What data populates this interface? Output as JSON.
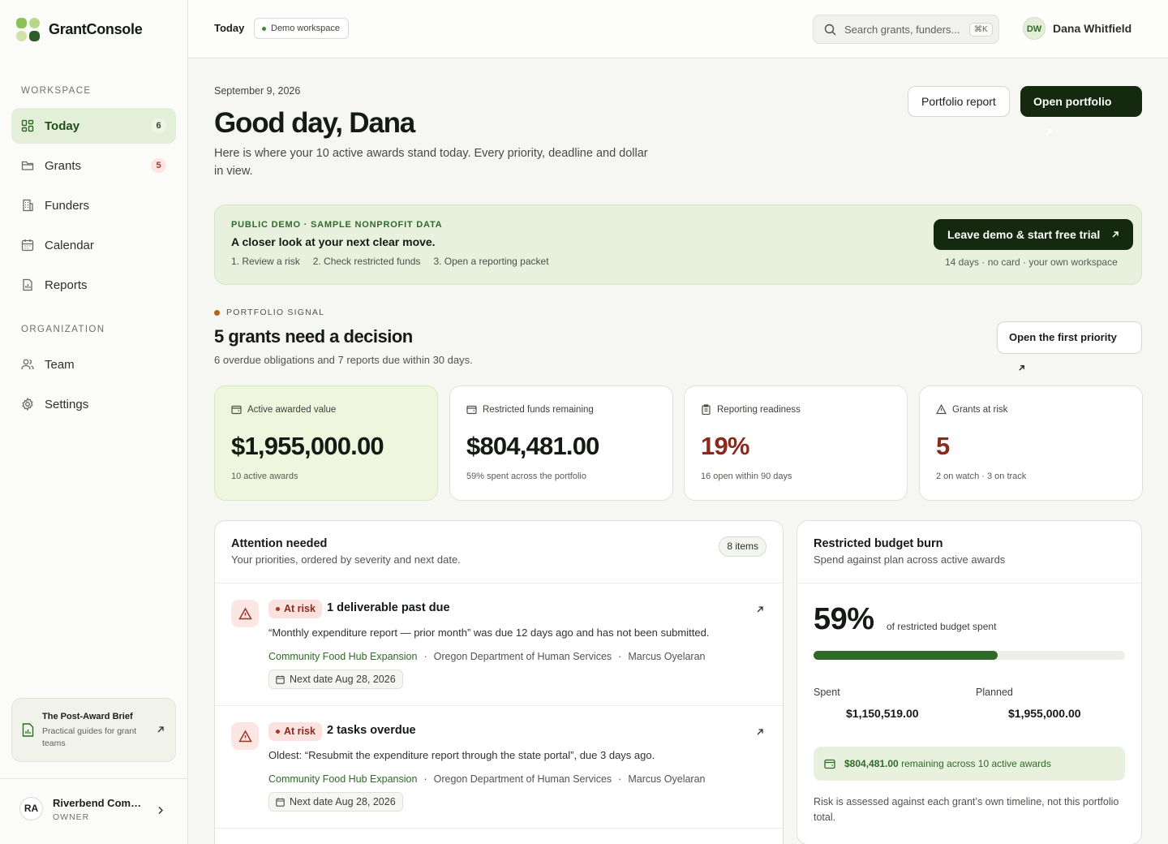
{
  "brand": {
    "name": "GrantConsole"
  },
  "sidebar": {
    "workspace_heading": "WORKSPACE",
    "organization_heading": "ORGANIZATION",
    "workspace_items": [
      {
        "label": "Today",
        "badge": "6",
        "icon": "dashboard-icon"
      },
      {
        "label": "Grants",
        "badge": "5",
        "icon": "folder-icon"
      },
      {
        "label": "Funders",
        "icon": "building-icon"
      },
      {
        "label": "Calendar",
        "icon": "calendar-icon"
      },
      {
        "label": "Reports",
        "icon": "report-icon"
      }
    ],
    "organization_items": [
      {
        "label": "Team",
        "icon": "users-icon"
      },
      {
        "label": "Settings",
        "icon": "gear-icon"
      }
    ],
    "brief": {
      "title": "The Post-Award Brief",
      "subtitle": "Practical guides for grant teams"
    },
    "org": {
      "initials": "RA",
      "name": "Riverbend Com…",
      "role": "OWNER"
    }
  },
  "topbar": {
    "title": "Today",
    "workspace_pill": "Demo workspace",
    "search_placeholder": "Search grants, funders...",
    "search_shortcut": "⌘K",
    "user": {
      "initials": "DW",
      "name": "Dana Whitfield"
    }
  },
  "header": {
    "date": "September 9, 2026",
    "greeting": "Good day, Dana",
    "intro": "Here is where your 10 active awards stand today. Every priority, deadline and dollar in view.",
    "portfolio_report_label": "Portfolio report",
    "open_portfolio_label": "Open portfolio"
  },
  "banner": {
    "eyebrow": "PUBLIC DEMO · SAMPLE NONPROFIT DATA",
    "title": "A closer look at your next clear move.",
    "steps": [
      "1. Review a risk",
      "2. Check restricted funds",
      "3. Open a reporting packet"
    ],
    "cta_label": "Leave demo & start free trial",
    "note": "14 days · no card · your own workspace"
  },
  "signal": {
    "eyebrow": "PORTFOLIO SIGNAL",
    "title": "5 grants need a decision",
    "subtitle": "6 overdue obligations and 7 reports due within 30 days.",
    "button_label": "Open the first priority"
  },
  "kpis": [
    {
      "label": "Active awarded value",
      "value": "$1,955,000.00",
      "sub": "10 active awards",
      "icon": "wallet-icon"
    },
    {
      "label": "Restricted funds remaining",
      "value": "$804,481.00",
      "sub": "59% spent across the portfolio",
      "icon": "wallet-icon"
    },
    {
      "label": "Reporting readiness",
      "value": "19%",
      "sub": "16 open within 90 days",
      "icon": "clipboard-icon"
    },
    {
      "label": "Grants at risk",
      "value": "5",
      "sub": "2 on watch · 3 on track",
      "icon": "warning-icon"
    }
  ],
  "attention": {
    "title": "Attention needed",
    "subtitle": "Your priorities, ordered by severity and next date.",
    "count_label": "8 items",
    "items": [
      {
        "status": "At risk",
        "title": "1 deliverable past due",
        "description": "“Monthly expenditure report — prior month” was due 12 days ago and has not been submitted.",
        "grant": "Community Food Hub Expansion",
        "funder": "Oregon Department of Human Services",
        "owner": "Marcus Oyelaran",
        "sep": "·",
        "next_date": "Next date Aug 28, 2026"
      },
      {
        "status": "At risk",
        "title": "2 tasks overdue",
        "description": "Oldest: “Resubmit the expenditure report through the state portal”, due 3 days ago.",
        "grant": "Community Food Hub Expansion",
        "funder": "Oregon Department of Human Services",
        "owner": "Marcus Oyelaran",
        "sep": "·",
        "next_date": "Next date Aug 28, 2026"
      }
    ]
  },
  "burn": {
    "title": "Restricted budget burn",
    "subtitle": "Spend against plan across active awards",
    "percent_label": "59%",
    "percent_value": 0.59,
    "percent_caption": "of restricted budget spent",
    "spent_label": "Spent",
    "spent_value": "$1,150,519.00",
    "planned_label": "Planned",
    "planned_value": "$1,955,000.00",
    "remaining_amount": "$804,481.00",
    "remaining_text": "remaining across 10 active awards",
    "note": "Risk is assessed against each grant’s own timeline, not this portfolio total."
  },
  "colors": {
    "accent": "#2f6a28",
    "dark": "#15290f",
    "risk": "#8a2a1e",
    "highlight": "#eef6dd"
  }
}
